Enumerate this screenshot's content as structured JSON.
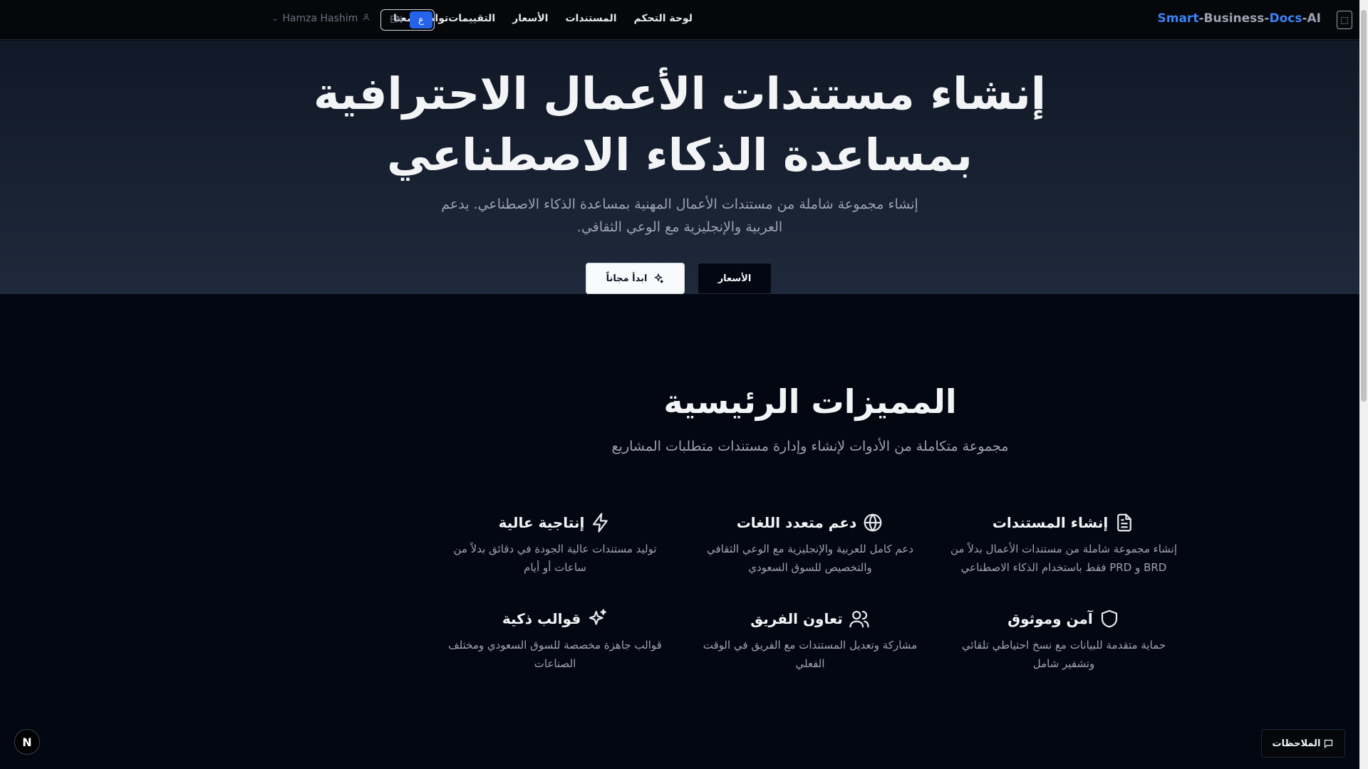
{
  "brand": {
    "part1": "Smart",
    "part2": "-Business-",
    "part3": "Docs",
    "part4": "-AI"
  },
  "nav": {
    "links": [
      "لوحة التحكم",
      "المستندات",
      "الأسعار",
      "التقييمات",
      "تواصل معنا"
    ],
    "lang_en": "EN",
    "lang_ar": "ع",
    "user_name": "Hamza Hashim"
  },
  "hero": {
    "title_line1": "إنشاء مستندات الأعمال الاحترافية",
    "title_line2": "بمساعدة الذكاء الاصطناعي",
    "subtitle_line1": "إنشاء مجموعة شاملة من مستندات الأعمال المهنية بمساعدة الذكاء الاصطناعي. يدعم",
    "subtitle_line2": "العربية والإنجليزية مع الوعي الثقافي.",
    "start_button": "ابدأ مجاناً",
    "pricing_button": "الأسعار"
  },
  "features": {
    "title": "المميزات الرئيسية",
    "subtitle": "مجموعة متكاملة من الأدوات لإنشاء وإدارة مستندات متطلبات المشاريع",
    "items": [
      {
        "icon": "document-icon",
        "title": "إنشاء المستندات",
        "desc": "إنشاء مجموعة شاملة من مستندات الأعمال بدلاً من BRD و PRD فقط باستخدام الذكاء الاصطناعي"
      },
      {
        "icon": "globe-icon",
        "title": "دعم متعدد اللغات",
        "desc": "دعم كامل للعربية والإنجليزية مع الوعي الثقافي والتخصيص للسوق السعودي"
      },
      {
        "icon": "lightning-icon",
        "title": "إنتاجية عالية",
        "desc": "توليد مستندات عالية الجودة في دقائق بدلاً من ساعات أو أيام"
      },
      {
        "icon": "shield-icon",
        "title": "آمن وموثوق",
        "desc": "حماية متقدمة للبيانات مع نسخ احتياطي تلقائي وتشفير شامل"
      },
      {
        "icon": "users-icon",
        "title": "تعاون الفريق",
        "desc": "مشاركة وتعديل المستندات مع الفريق في الوقت الفعلي"
      },
      {
        "icon": "sparkles-icon",
        "title": "قوالب ذكية",
        "desc": "قوالب جاهزة مخصصة للسوق السعودي ومختلف الصناعات"
      }
    ]
  },
  "floating": {
    "next_badge": "N",
    "notes_button": "الملاحظات"
  },
  "colors": {
    "accent": "#3b82f6",
    "background": "#030712",
    "hero_gradient_top": "#111827",
    "hero_gradient_bottom": "#1e293b"
  }
}
